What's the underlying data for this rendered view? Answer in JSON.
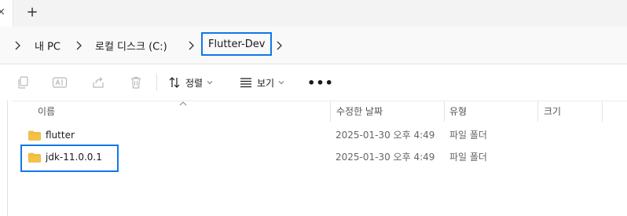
{
  "tabs": {
    "partial_tab_glyph": "×",
    "new_tab_glyph": "+"
  },
  "breadcrumb": {
    "items": [
      "내 PC",
      "로컬 디스크 (C:)",
      "Flutter-Dev"
    ]
  },
  "toolbar": {
    "sort_label": "정렬",
    "view_label": "보기",
    "more_label": "•••",
    "icons": [
      "copy-icon",
      "rename-icon",
      "share-icon",
      "delete-icon"
    ]
  },
  "columns": {
    "name": "이름",
    "date": "수정한 날짜",
    "type": "유형",
    "size": "크기"
  },
  "files": [
    {
      "name": "flutter",
      "date": "2025-01-30 오후 4:49",
      "type": "파일 폴더"
    },
    {
      "name": "jdk-11.0.0.1",
      "date": "2025-01-30 오후 4:49",
      "type": "파일 폴더"
    }
  ],
  "colors": {
    "highlight": "#1177e8",
    "folder": "#f5c242"
  }
}
